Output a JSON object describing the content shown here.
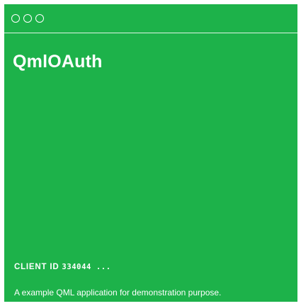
{
  "window": {
    "controls": [
      {
        "name": "window-control-close-icon"
      },
      {
        "name": "window-control-minimize-icon"
      },
      {
        "name": "window-control-maximize-icon"
      }
    ]
  },
  "app": {
    "title": "QmlOAuth",
    "client_id_label": "CLIENT ID",
    "client_id_value": "334044 ...",
    "description": "A example QML application for demonstration purpose."
  },
  "colors": {
    "background": "#1db24a",
    "foreground": "#ffffff"
  }
}
